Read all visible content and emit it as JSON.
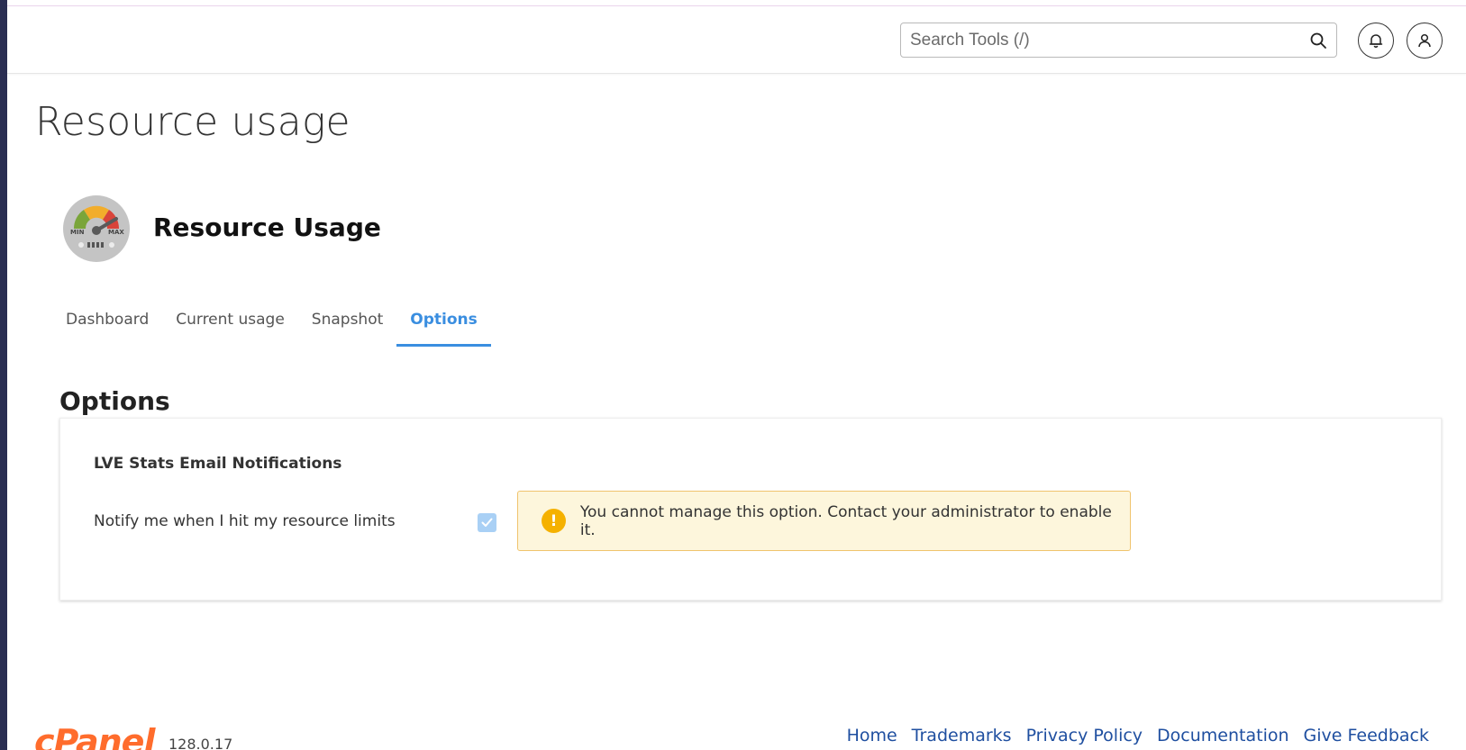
{
  "header": {
    "search": {
      "placeholder": "Search Tools (/)",
      "value": ""
    },
    "icons": {
      "search": "search-icon",
      "notifications": "bell-icon",
      "user": "user-icon"
    }
  },
  "page": {
    "title": "Resource usage"
  },
  "app": {
    "title": "Resource Usage",
    "icon": "gauge-icon",
    "gauge_labels": {
      "min": "MIN",
      "max": "MAX"
    }
  },
  "tabs": [
    {
      "label": "Dashboard",
      "active": false
    },
    {
      "label": "Current usage",
      "active": false
    },
    {
      "label": "Snapshot",
      "active": false
    },
    {
      "label": "Options",
      "active": true
    }
  ],
  "options": {
    "heading": "Options",
    "section_title": "LVE Stats Email Notifications",
    "notify_label": "Notify me when I hit my resource limits",
    "notify_checked": true,
    "notify_disabled": true,
    "alert": {
      "icon": "exclamation-icon",
      "symbol": "!",
      "text": "You cannot manage this option. Contact your administrator to enable it."
    }
  },
  "footer": {
    "logo": "cPanel",
    "version": "128.0.17",
    "links": [
      "Home",
      "Trademarks",
      "Privacy Policy",
      "Documentation",
      "Give Feedback"
    ]
  },
  "colors": {
    "accent": "#3a8ee0",
    "alert_bg": "#fdf6dc",
    "alert_border": "#f0c36d",
    "alert_icon": "#f5b100",
    "logo": "#ff6c2c",
    "link": "#1f4fa0",
    "rail": "#2a2e52"
  }
}
